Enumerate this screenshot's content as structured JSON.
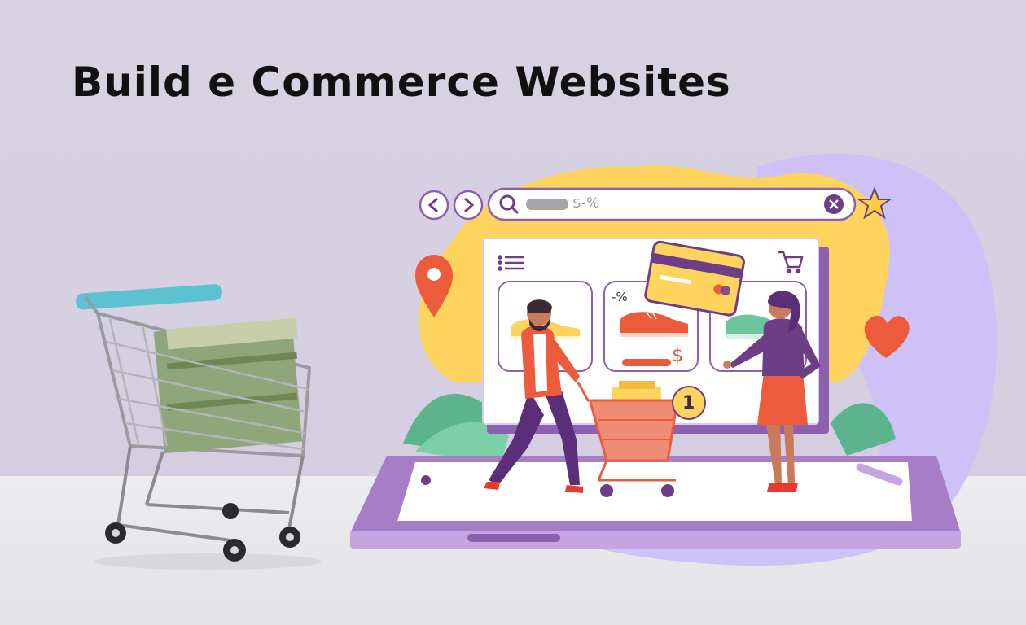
{
  "page": {
    "title": "Build e Commerce Websites"
  },
  "browser": {
    "search_text": "$-%",
    "icons": [
      "chevron-left-icon",
      "chevron-right-icon",
      "search-icon",
      "close-icon",
      "star-icon"
    ]
  },
  "store": {
    "discount_tag": "-%",
    "price_symbol": "$",
    "cart_count": "1"
  },
  "colors": {
    "wall": "#d8d3e3",
    "floor": "#e8e8ea",
    "yellow_blob": "#ffd45e",
    "lavender_blob": "#cfc3f8",
    "device_purple": "#b893d6",
    "accent_orange": "#ec5b3c",
    "dark_purple": "#6b3e86"
  }
}
